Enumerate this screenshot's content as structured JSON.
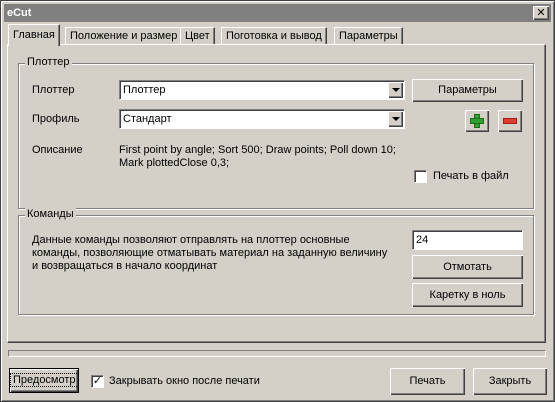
{
  "window": {
    "title": "eCut",
    "close_glyph": "✕"
  },
  "tabs": [
    {
      "label": "Главная",
      "active": true
    },
    {
      "label": "Положение и размер",
      "active": false
    },
    {
      "label": "Цвет",
      "active": false
    },
    {
      "label": "Поготовка и вывод",
      "active": false
    },
    {
      "label": "Параметры",
      "active": false
    }
  ],
  "plotter_group": {
    "legend": "Плоттер",
    "plotter_label": "Плоттер",
    "plotter_value": "Плоттер",
    "params_button": "Параметры",
    "profile_label": "Профиль",
    "profile_value": "Стандарт",
    "description_label": "Описание",
    "description_line1": "First point by angle; Sort 500; Draw points; Poll down 10;",
    "description_line2": "Mark plottedClose 0,3;",
    "print_to_file_label": "Печать в файл",
    "print_to_file_checked": false,
    "add_icon": "plus-icon",
    "remove_icon": "minus-icon",
    "add_color": "#2fa02f",
    "remove_color": "#e03c32"
  },
  "commands_group": {
    "legend": "Команды",
    "text_line1": "Данные команды позволяют отправлять на плоттер основные",
    "text_line2": "команды, позволяющие отматывать материал на заданную величину",
    "text_line3": "и возвращаться в начало координат",
    "amount_value": "24",
    "rewind_button": "Отмотать",
    "carriage_button": "Каретку в ноль"
  },
  "footer": {
    "preview_button": "Предосмотр",
    "close_after_print_label": "Закрывать окно после печати",
    "close_after_print_checked": true,
    "print_button": "Печать",
    "close_button": "Закрыть"
  }
}
